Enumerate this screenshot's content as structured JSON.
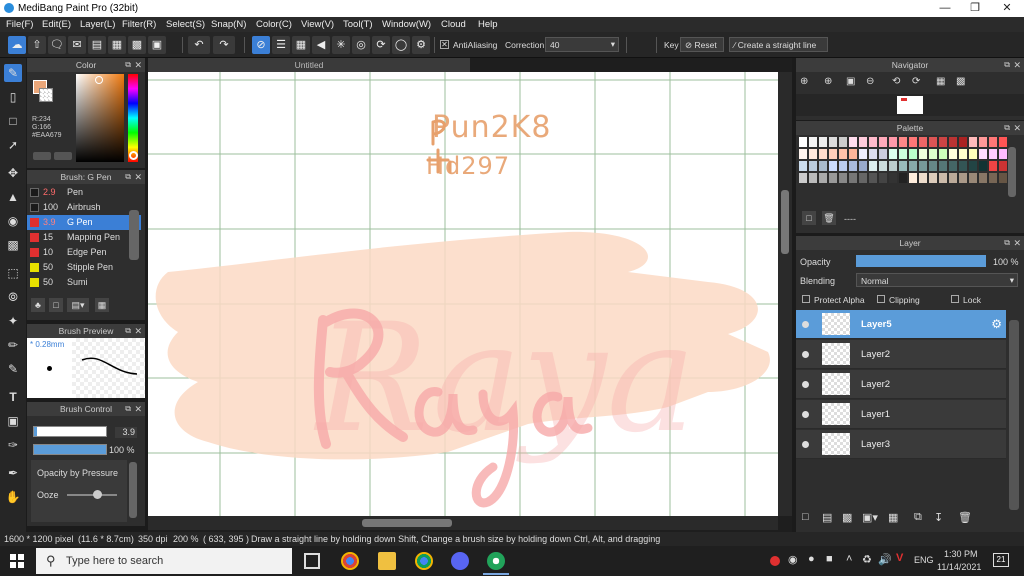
{
  "app": {
    "title": "MediBang Paint Pro (32bit)",
    "doc_tab": "Untitled"
  },
  "menu": [
    "File(F)",
    "Edit(E)",
    "Layer(L)",
    "Filter(R)",
    "Select(S)",
    "Snap(N)",
    "Color(C)",
    "View(V)",
    "Tool(T)",
    "Window(W)",
    "Cloud",
    "Help"
  ],
  "toolbar": {
    "antialias_label": "AntiAliasing",
    "correction_label": "Correction",
    "correction_value": "40",
    "key_label": "Key",
    "reset_label": "Reset",
    "straight_line_label": "Create a straight line"
  },
  "color_panel": {
    "title": "Color",
    "r": "R:234",
    "g": "G:166",
    "hex": "#EAA679",
    "primary": "#EAA679"
  },
  "brush_panel": {
    "title": "Brush: G Pen",
    "items": [
      {
        "size": "2.9",
        "name": "Pen",
        "color": "#1a1a1a",
        "size_color": "#ff6b6b"
      },
      {
        "size": "100",
        "name": "Airbrush",
        "color": "#1a1a1a",
        "size_color": "#dddddd"
      },
      {
        "size": "3.9",
        "name": "G Pen",
        "color": "#e03030",
        "size_color": "#ff8080"
      },
      {
        "size": "15",
        "name": "Mapping Pen",
        "color": "#e03030",
        "size_color": "#dddddd"
      },
      {
        "size": "10",
        "name": "Edge Pen",
        "color": "#e03030",
        "size_color": "#dddddd"
      },
      {
        "size": "50",
        "name": "Stipple Pen",
        "color": "#e8e000",
        "size_color": "#dddddd"
      },
      {
        "size": "50",
        "name": "Sumi",
        "color": "#e8e000",
        "size_color": "#dddddd"
      }
    ]
  },
  "brush_preview": {
    "title": "Brush Preview",
    "size": "* 0.28mm"
  },
  "brush_control": {
    "title": "Brush Control",
    "size_value": "3.9",
    "opacity_value": "100 %",
    "opacity_pressure_label": "Opacity by Pressure",
    "ooze_label": "Ooze"
  },
  "canvas": {
    "watermark_line1": "Pun2K8",
    "watermark_line2": "Hd297",
    "art_text": "Raya"
  },
  "navigator": {
    "title": "Navigator"
  },
  "palette": {
    "title": "Palette",
    "dash": "----"
  },
  "layer_panel": {
    "title": "Layer",
    "opacity_label": "Opacity",
    "opacity_value": "100 %",
    "blending_label": "Blending",
    "blending_value": "Normal",
    "protect_alpha": "Protect Alpha",
    "clipping": "Clipping",
    "lock": "Lock",
    "layers": [
      "Layer5",
      "Layer2",
      "Layer2",
      "Layer1",
      "Layer3"
    ],
    "selected_index": 0
  },
  "status": {
    "size": "1600 * 1200 pixel",
    "cm": "(11.6 * 8.7cm)",
    "dpi": "350 dpi",
    "zoom": "200 %",
    "coords": "( 633, 395 )",
    "hint": "Draw a straight line by holding down Shift, Change a brush size by holding down Ctrl, Alt, and dragging"
  },
  "taskbar": {
    "search_placeholder": "Type here to search",
    "lang": "ENG",
    "time": "1:30 PM",
    "date": "11/14/2021",
    "notif": "21"
  }
}
